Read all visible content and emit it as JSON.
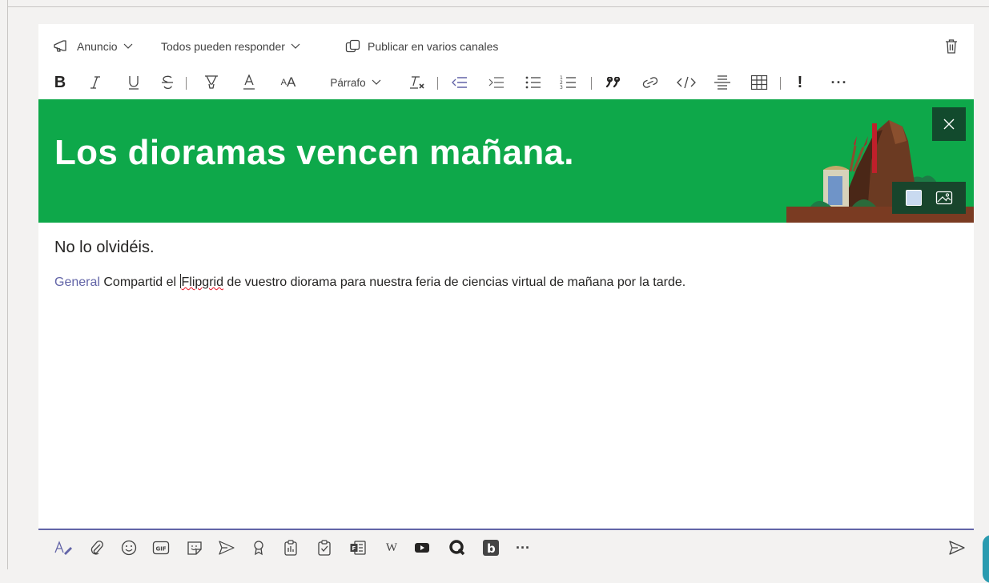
{
  "toolbar_top": {
    "announcement_label": "Anuncio",
    "reply_label": "Todos pueden responder",
    "crosspost_label": "Publicar en varios canales"
  },
  "format_toolbar": {
    "paragraph_label": "Párrafo"
  },
  "banner": {
    "headline": "Los dioramas vencen mañana.",
    "color": "#0ea84a"
  },
  "message": {
    "subject": "No lo olvidéis.",
    "mention": "General",
    "before_spell": " Compartid el ",
    "spell_word": "Flipgrid",
    "after_spell": " de vuestro diorama para nuestra feria de ciencias virtual de mañana por la tarde."
  },
  "colors": {
    "accent": "#6264a7",
    "banner_dark": "#124a2d"
  }
}
